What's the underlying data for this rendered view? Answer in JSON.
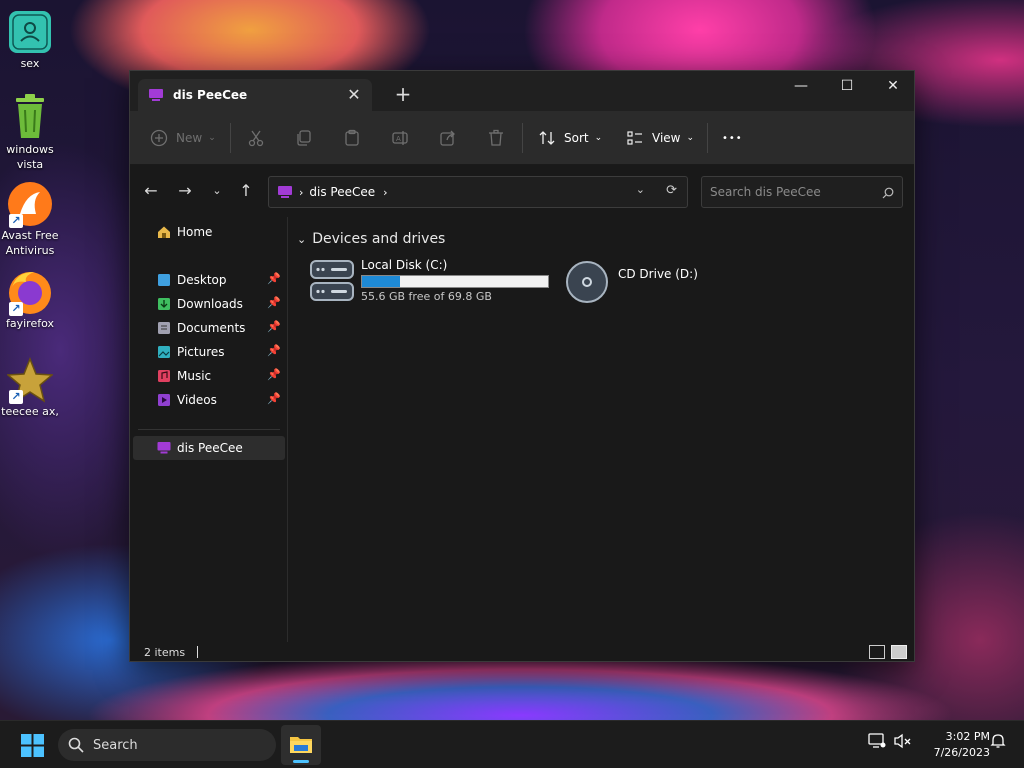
{
  "desktop": {
    "icons": [
      {
        "label": "sex"
      },
      {
        "label": "windows\nvista"
      },
      {
        "label": "Avast Free\nAntivirus"
      },
      {
        "label": "fayirefox"
      },
      {
        "label": "teecee ax,"
      }
    ]
  },
  "window": {
    "tab_title": "dis PeeCee",
    "new_tab_symbol": "+",
    "close_tab_symbol": "✕",
    "controls": {
      "minimize": "—",
      "maximize": "☐",
      "close": "✕"
    }
  },
  "toolbar": {
    "new_label": "New",
    "sort_label": "Sort",
    "view_label": "View",
    "more_label": "•••"
  },
  "address": {
    "current": "dis PeeCee",
    "search_placeholder": "Search dis PeeCee"
  },
  "sidebar": {
    "home": "Home",
    "quick_access": [
      {
        "label": "Desktop",
        "color": "#3fa0e0"
      },
      {
        "label": "Downloads",
        "color": "#3fbf60"
      },
      {
        "label": "Documents",
        "color": "#a0a0b0"
      },
      {
        "label": "Pictures",
        "color": "#30b0c0"
      },
      {
        "label": "Music",
        "color": "#e04060"
      },
      {
        "label": "Videos",
        "color": "#9040d0"
      }
    ],
    "this_pc": "dis PeeCee"
  },
  "content": {
    "group_title": "Devices and drives",
    "drives": [
      {
        "name": "Local Disk (C:)",
        "free_text": "55.6 GB free of 69.8 GB",
        "used_fraction": 0.203
      },
      {
        "name": "CD Drive (D:)"
      }
    ]
  },
  "status": {
    "item_count": "2 items"
  },
  "taskbar": {
    "search_label": "Search",
    "time": "3:02 PM",
    "date": "7/26/2023"
  },
  "colors": {
    "accent": "#1e8ad6",
    "this_pc_icon": "#a23bd6"
  }
}
